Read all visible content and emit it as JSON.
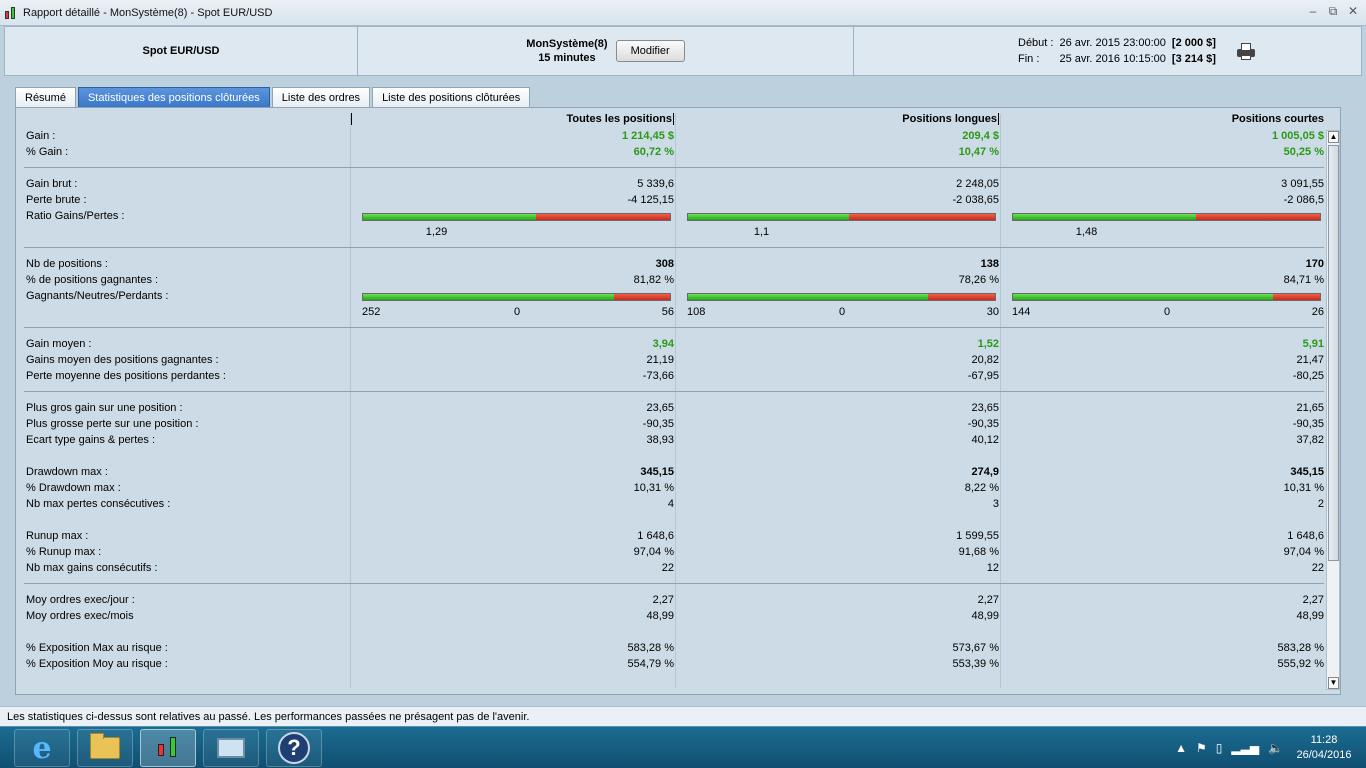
{
  "window": {
    "title": "Rapport détaillé - MonSystème(8) - Spot EUR/USD",
    "controls": [
      "–",
      "⧉",
      "✕"
    ]
  },
  "header": {
    "instrument": "Spot EUR/USD",
    "system": "MonSystème(8)",
    "timeframe": "15 minutes",
    "modify_label": "Modifier",
    "start_label": "Début :",
    "start_date": "26 avr. 2015 23:00:00",
    "start_capital": "[2 000 $]",
    "end_label": "Fin :",
    "end_date": "25 avr. 2016 10:15:00",
    "end_capital": "[3 214 $]"
  },
  "tabs": [
    {
      "label": "Résumé",
      "active": false
    },
    {
      "label": "Statistiques des positions clôturées",
      "active": true
    },
    {
      "label": "Liste des ordres",
      "active": false
    },
    {
      "label": "Liste des positions clôturées",
      "active": false
    }
  ],
  "columns": [
    "Toutes les positions",
    "Positions longues",
    "Positions courtes"
  ],
  "stats": {
    "gain": {
      "label": "Gain :",
      "values": [
        "1 214,45 $",
        "209,4 $",
        "1 005,05 $"
      ]
    },
    "pct_gain": {
      "label": "% Gain :",
      "values": [
        "60,72 %",
        "10,47 %",
        "50,25 %"
      ]
    },
    "gross_gain": {
      "label": "Gain brut :",
      "values": [
        "5 339,6",
        "2 248,05",
        "3 091,55"
      ]
    },
    "gross_loss": {
      "label": "Perte brute :",
      "values": [
        "-4 125,15",
        "-2 038,65",
        "-2 086,5"
      ]
    },
    "ratio": {
      "label": "Ratio Gains/Pertes :",
      "values": [
        "1,29",
        "1,1",
        "1,48"
      ],
      "fill": [
        0.564,
        0.524,
        0.597
      ]
    },
    "nb_positions": {
      "label": "Nb de positions :",
      "values": [
        "308",
        "138",
        "170"
      ]
    },
    "pct_winning": {
      "label": "% de positions gagnantes :",
      "values": [
        "81,82 %",
        "78,26 %",
        "84,71 %"
      ]
    },
    "gnp": {
      "label": "Gagnants/Neutres/Perdants :",
      "wins": [
        "252",
        "108",
        "144"
      ],
      "neutral": [
        "0",
        "0",
        "0"
      ],
      "losses": [
        "56",
        "30",
        "26"
      ],
      "fill": [
        0.818,
        0.783,
        0.847
      ]
    },
    "avg_gain": {
      "label": "Gain moyen :",
      "values": [
        "3,94",
        "1,52",
        "5,91"
      ]
    },
    "avg_win": {
      "label": "Gains moyen des positions gagnantes :",
      "values": [
        "21,19",
        "20,82",
        "21,47"
      ]
    },
    "avg_loss": {
      "label": "Perte moyenne des positions perdantes :",
      "values": [
        "-73,66",
        "-67,95",
        "-80,25"
      ]
    },
    "max_gain": {
      "label": "Plus gros gain sur une position :",
      "values": [
        "23,65",
        "23,65",
        "21,65"
      ]
    },
    "max_loss": {
      "label": "Plus grosse perte sur une position :",
      "values": [
        "-90,35",
        "-90,35",
        "-90,35"
      ]
    },
    "std": {
      "label": "Ecart type gains & pertes :",
      "values": [
        "38,93",
        "40,12",
        "37,82"
      ]
    },
    "dd_max": {
      "label": "Drawdown max :",
      "values": [
        "345,15",
        "274,9",
        "345,15"
      ]
    },
    "pct_dd": {
      "label": "% Drawdown max :",
      "values": [
        "10,31 %",
        "8,22 %",
        "10,31 %"
      ]
    },
    "max_consec_loss": {
      "label": "Nb max pertes consécutives :",
      "values": [
        "4",
        "3",
        "2"
      ]
    },
    "runup": {
      "label": "Runup max :",
      "values": [
        "1 648,6",
        "1 599,55",
        "1 648,6"
      ]
    },
    "pct_runup": {
      "label": "% Runup max :",
      "values": [
        "97,04 %",
        "91,68 %",
        "97,04 %"
      ]
    },
    "max_consec_gain": {
      "label": "Nb max gains consécutifs :",
      "values": [
        "22",
        "12",
        "22"
      ]
    },
    "orders_day": {
      "label": "Moy ordres exec/jour :",
      "values": [
        "2,27",
        "2,27",
        "2,27"
      ]
    },
    "orders_month": {
      "label": "Moy ordres exec/mois",
      "values": [
        "48,99",
        "48,99",
        "48,99"
      ]
    },
    "exp_max": {
      "label": "% Exposition Max au risque :",
      "values": [
        "583,28 %",
        "573,67 %",
        "583,28 %"
      ]
    },
    "exp_avg": {
      "label": "% Exposition Moy au risque :",
      "values": [
        "554,79 %",
        "553,39 %",
        "555,92 %"
      ]
    }
  },
  "status_text": "Les statistiques ci-dessus sont relatives au passé. Les performances passées ne présagent pas de l'avenir.",
  "taskbar": {
    "time": "11:28",
    "date": "26/04/2016",
    "apps": [
      "internet-explorer",
      "file-explorer",
      "trading-app",
      "control-panel",
      "help"
    ]
  },
  "colors": {
    "positive": "#2a9a16",
    "active_tab": "#3b78c8",
    "ratio_green": "#26a612",
    "ratio_red": "#c82b1b"
  }
}
